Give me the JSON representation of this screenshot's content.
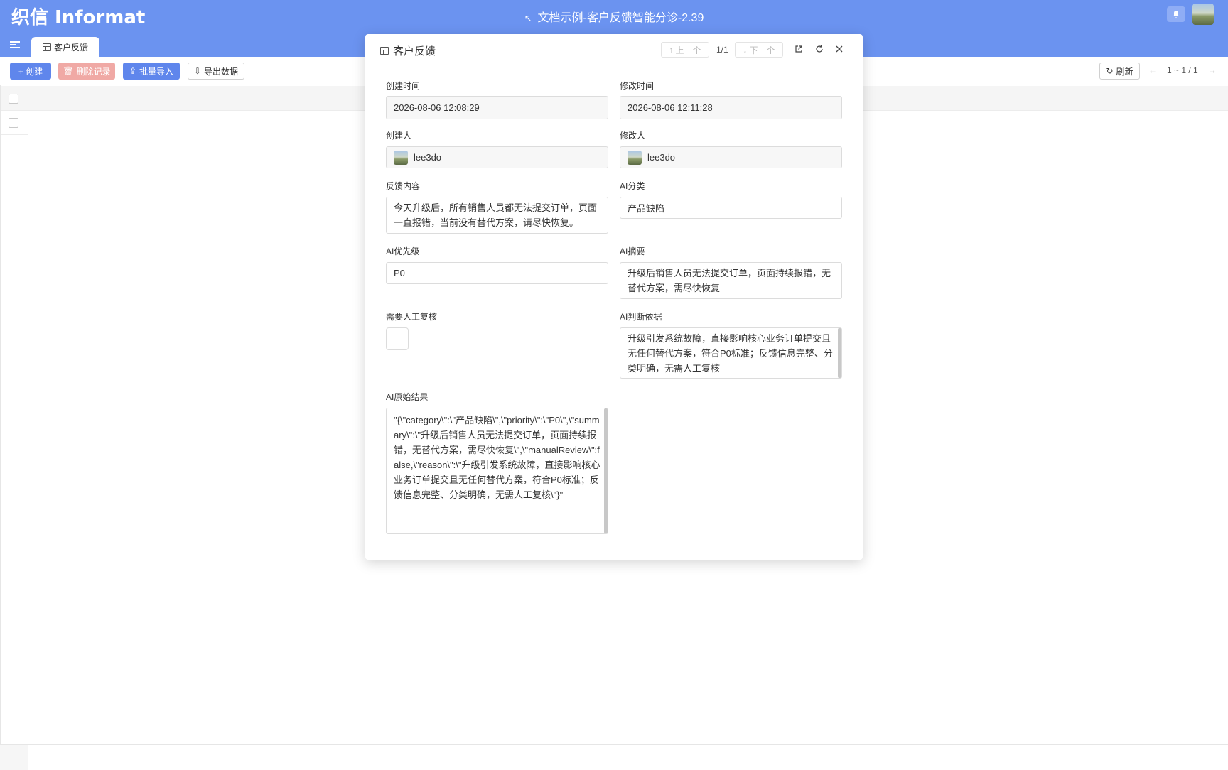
{
  "header": {
    "logo": "织信 Informat",
    "title": "文档示例-客户反馈智能分诊-2.39",
    "tab_label": "客户反馈"
  },
  "toolbar": {
    "create": "+ 创建",
    "delete": "删除记录",
    "import": "批量导入",
    "export": "导出数据",
    "refresh": "刷新",
    "range": "1 ~ 1 / 1"
  },
  "dialog": {
    "title": "客户反馈",
    "prev": "上一个",
    "next": "下一个",
    "count": "1/1",
    "fields": {
      "created_time": {
        "label": "创建时间",
        "value": "2026-08-06 12:08:29"
      },
      "modified_time": {
        "label": "修改时间",
        "value": "2026-08-06 12:11:28"
      },
      "creator": {
        "label": "创建人",
        "value": "lee3do"
      },
      "modifier": {
        "label": "修改人",
        "value": "lee3do"
      },
      "feedback": {
        "label": "反馈内容",
        "value": "今天升级后，所有销售人员都无法提交订单，页面一直报错，当前没有替代方案，请尽快恢复。"
      },
      "ai_category": {
        "label": "AI分类",
        "value": "产品缺陷"
      },
      "ai_priority": {
        "label": "AI优先级",
        "value": "P0"
      },
      "ai_summary": {
        "label": "AI摘要",
        "value": "升级后销售人员无法提交订单，页面持续报错，无替代方案，需尽快恢复"
      },
      "manual_review": {
        "label": "需要人工复核",
        "checked": false
      },
      "ai_reason": {
        "label": "AI判断依据",
        "value": "升级引发系统故障，直接影响核心业务订单提交且无任何替代方案，符合P0标准；反馈信息完整、分类明确，无需人工复核"
      },
      "ai_raw": {
        "label": "AI原始结果",
        "value": "\"{\\\"category\\\":\\\"产品缺陷\\\",\\\"priority\\\":\\\"P0\\\",\\\"summary\\\":\\\"升级后销售人员无法提交订单，页面持续报错，无替代方案，需尽快恢复\\\",\\\"manualReview\\\":false,\\\"reason\\\":\\\"升级引发系统故障，直接影响核心业务订单提交且无任何替代方案，符合P0标准；反馈信息完整、分类明确，无需人工复核\\\"}\""
      }
    }
  },
  "colors": {
    "brand": "#6b93f0",
    "primary_button": "#5f86ec",
    "danger_button": "#f0a9a5"
  }
}
